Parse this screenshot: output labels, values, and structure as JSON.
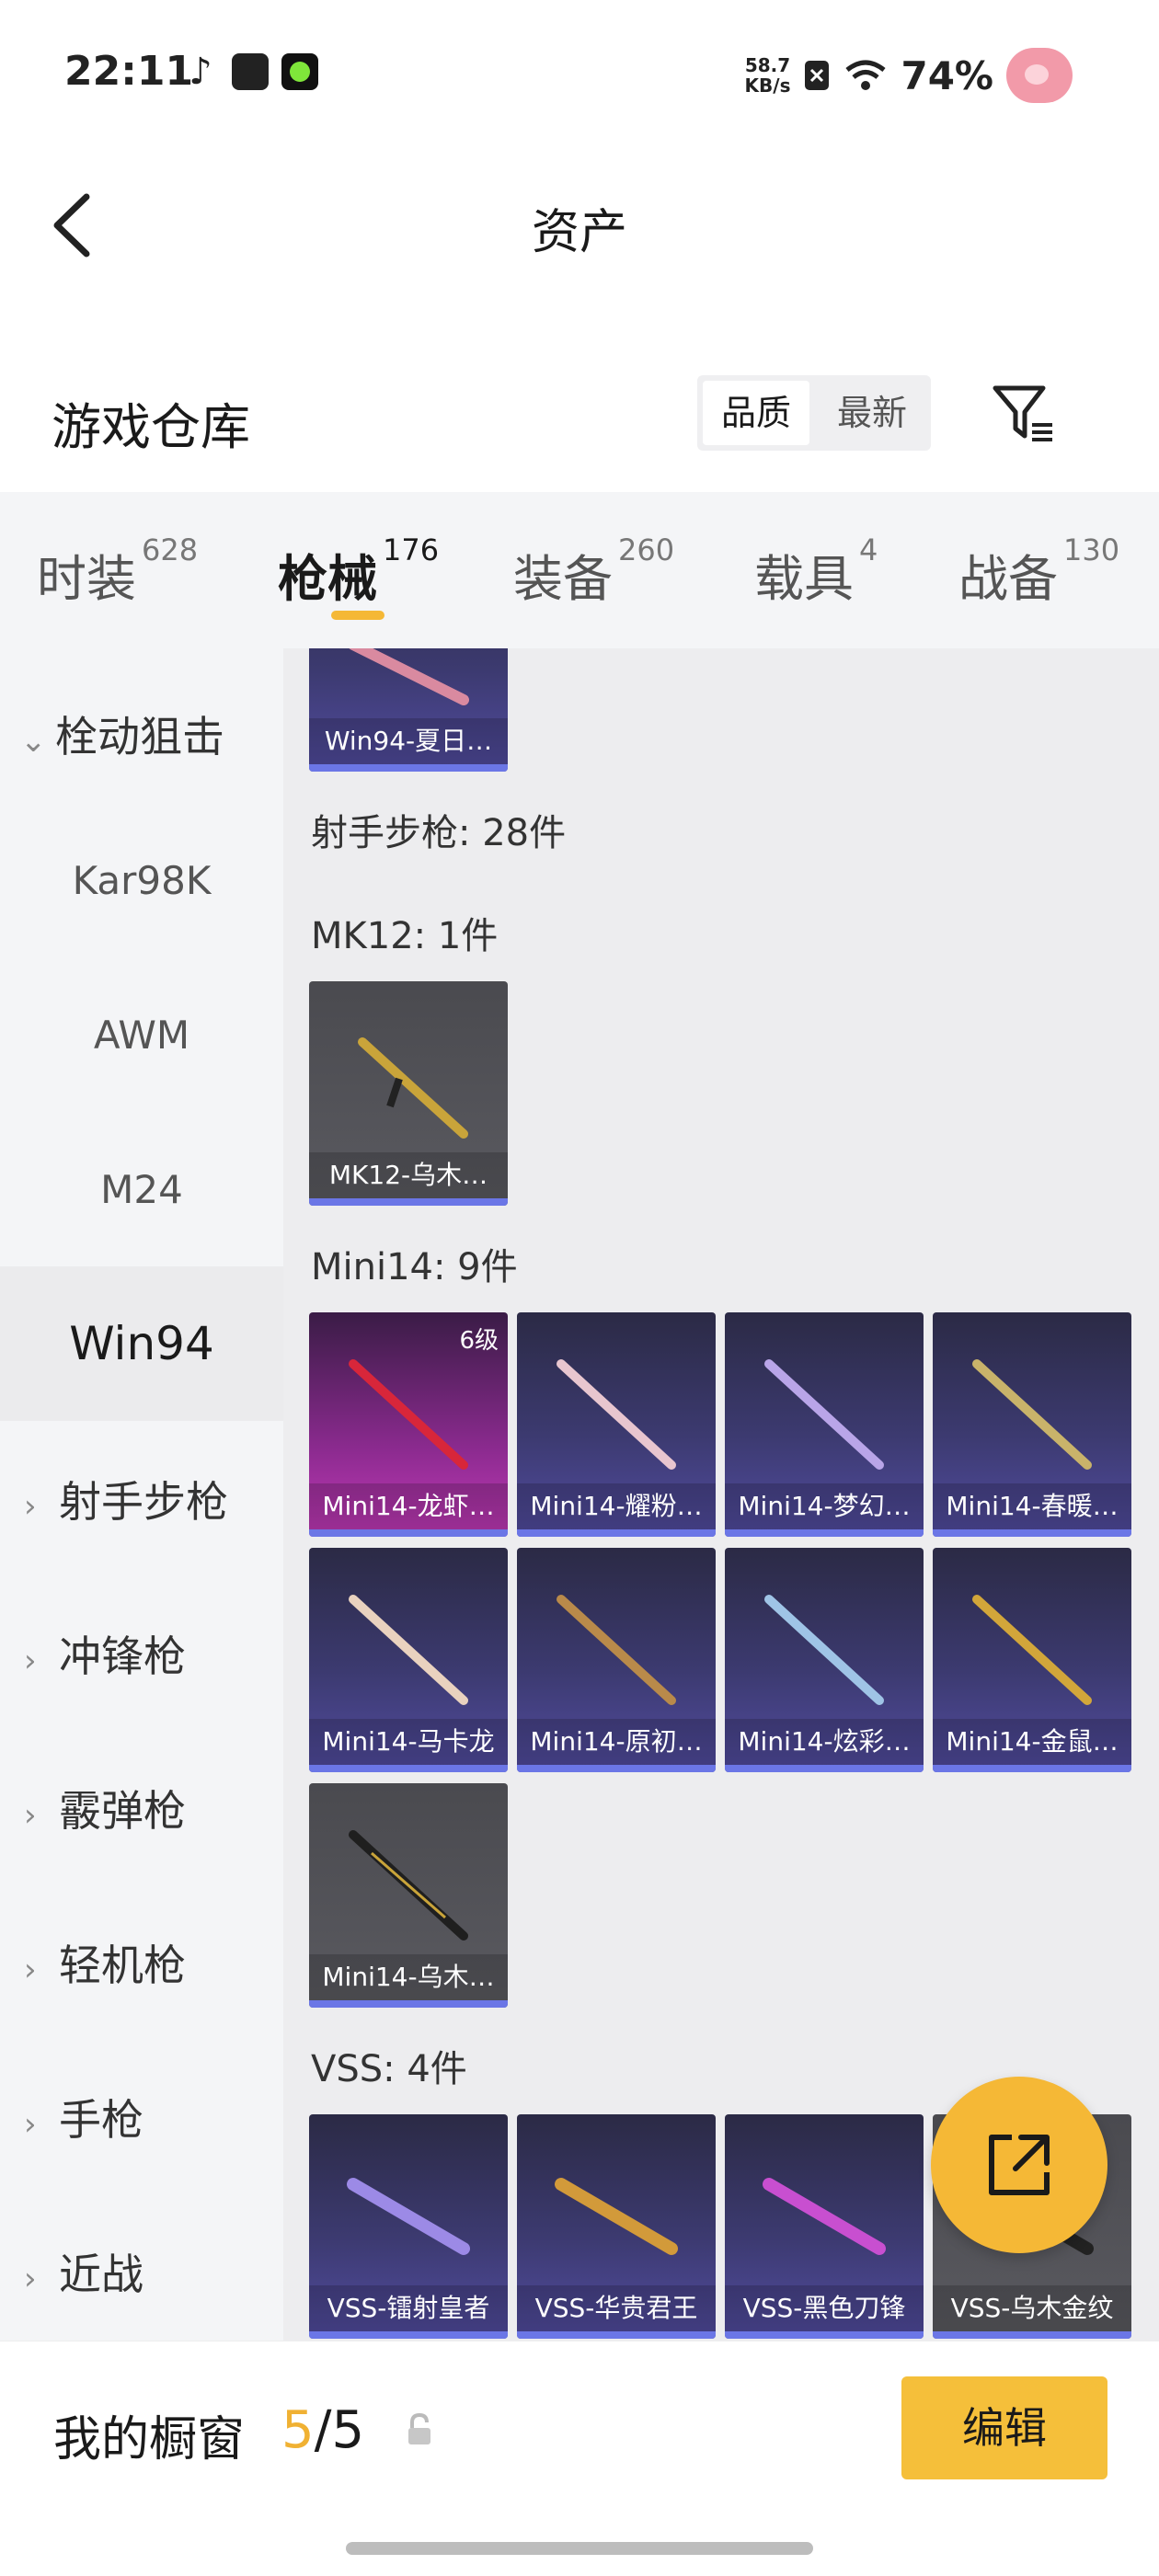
{
  "status_bar": {
    "time": "22:11",
    "net_speed_value": "58.7",
    "net_speed_unit": "KB/s",
    "battery": "74%"
  },
  "header": {
    "title": "资产"
  },
  "section": {
    "title": "游戏仓库",
    "sort_quality": "品质",
    "sort_latest": "最新"
  },
  "tabs": [
    {
      "label": "时装",
      "count": "628"
    },
    {
      "label": "枪械",
      "count": "176"
    },
    {
      "label": "装备",
      "count": "260"
    },
    {
      "label": "载具",
      "count": "4"
    },
    {
      "label": "战备",
      "count": "130"
    }
  ],
  "sidebar": {
    "category_sniper": "栓动狙击",
    "sub_kar98k": "Kar98K",
    "sub_awm": "AWM",
    "sub_m24": "M24",
    "sub_win94": "Win94",
    "cat_dmr": "射手步枪",
    "cat_smg": "冲锋枪",
    "cat_shotgun": "霰弹枪",
    "cat_lmg": "轻机枪",
    "cat_pistol": "手枪",
    "cat_melee": "近战"
  },
  "content": {
    "win94_item": "Win94-夏日…",
    "dmr_total": "射手步枪: 28件",
    "mk12_label": "MK12: 1件",
    "mk12_items": [
      "MK12-乌木…"
    ],
    "mini14_label": "Mini14: 9件",
    "mini14_level": "6级",
    "mini14_items": [
      "Mini14-龙虾…",
      "Mini14-耀粉…",
      "Mini14-梦幻…",
      "Mini14-春暖…",
      "Mini14-马卡龙",
      "Mini14-原初…",
      "Mini14-炫彩…",
      "Mini14-金鼠…",
      "Mini14-乌木…"
    ],
    "vss_label": "VSS: 4件",
    "vss_items": [
      "VSS-镭射皇者",
      "VSS-华贵君王",
      "VSS-黑色刀锋",
      "VSS-乌木金纹"
    ]
  },
  "bottom": {
    "showcase_label": "我的橱窗",
    "count_current": "5",
    "count_sep_total": "/5",
    "edit_label": "编辑"
  },
  "colors": {
    "accent": "#f5b836",
    "card_purple": "#3c3a70",
    "card_gray": "#55555a",
    "card_pink": "#c23ab8"
  }
}
